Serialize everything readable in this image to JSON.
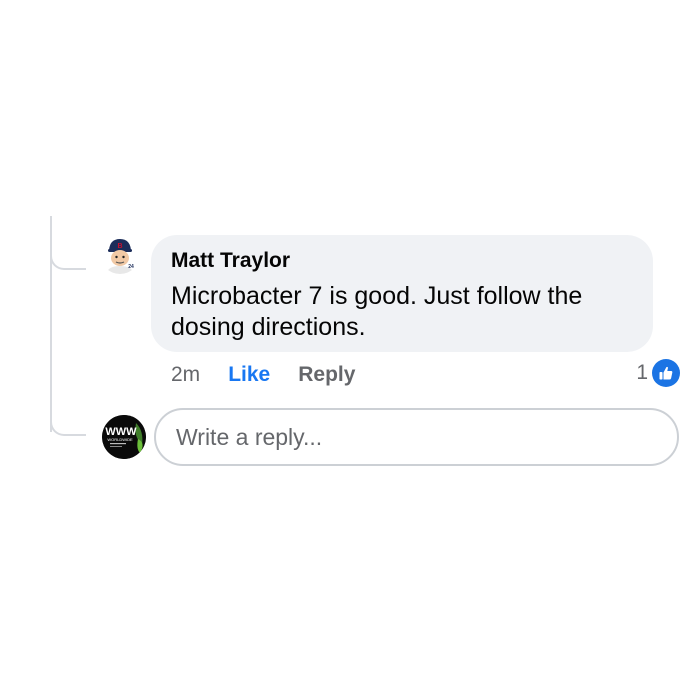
{
  "comment": {
    "author": "Matt Traylor",
    "text": "Microbacter 7 is good. Just follow the dosing directions.",
    "timestamp": "2m",
    "like_label": "Like",
    "reply_label": "Reply",
    "reaction_count": "1",
    "avatar_icon": "baseball-player-cartoon-icon",
    "avatar_number": "24"
  },
  "reply": {
    "placeholder": "Write a reply...",
    "avatar_icon": "worldwide-logo-icon",
    "avatar_logo_text": "WWW",
    "avatar_logo_subtext": "WORLDWIDE"
  },
  "colors": {
    "bubble": "#f0f2f5",
    "link_blue": "#1877f2",
    "secondary_text": "#65676b",
    "thread_line": "#d7dadf"
  }
}
